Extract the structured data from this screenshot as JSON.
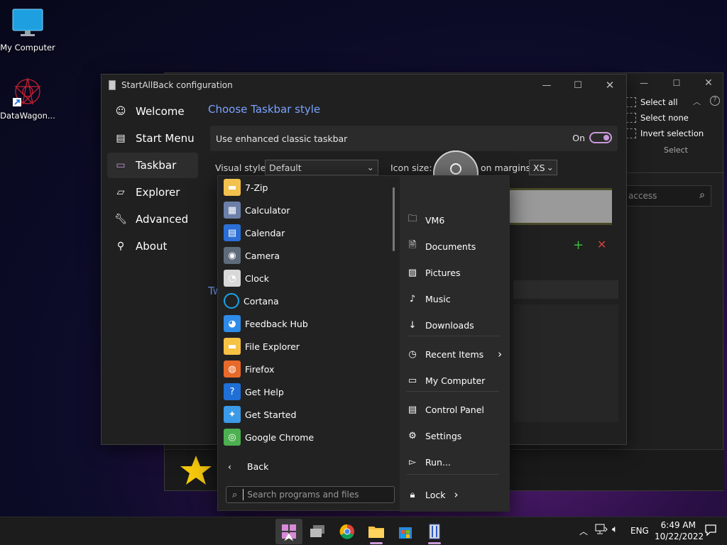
{
  "desktop": {
    "icons": [
      {
        "label": "My Computer"
      },
      {
        "label": "DataWagon..."
      }
    ]
  },
  "bg_window": {
    "ribbon": [
      "Select all",
      "Select none",
      "Invert selection"
    ],
    "ribbon_group_label": "Select",
    "search_placeholder": "access"
  },
  "window": {
    "title": "StartAllBack configuration",
    "nav": [
      {
        "label": "Welcome",
        "icon": "smiley-icon"
      },
      {
        "label": "Start Menu",
        "icon": "start-menu-icon"
      },
      {
        "label": "Taskbar",
        "icon": "taskbar-icon",
        "active": true
      },
      {
        "label": "Explorer",
        "icon": "explorer-icon"
      },
      {
        "label": "Advanced",
        "icon": "wrench-icon"
      },
      {
        "label": "About",
        "icon": "info-icon"
      }
    ],
    "content_title": "Choose Taskbar style",
    "enhanced_label": "Use enhanced classic taskbar",
    "toggle_state": "On",
    "visual_style_label": "Visual style:",
    "visual_style_value": "Default",
    "icon_size_label": "Icon size:",
    "icon_margins_label": "on margins:",
    "icon_margins_value": "XS",
    "section_partial": "Tw"
  },
  "start_menu": {
    "programs": [
      {
        "label": "7-Zip",
        "icon": "folder-icon",
        "color": "#f2c14e"
      },
      {
        "label": "Calculator",
        "icon": "calculator-icon",
        "color": "#6b7fa8"
      },
      {
        "label": "Calendar",
        "icon": "calendar-icon",
        "color": "#2b6fd6"
      },
      {
        "label": "Camera",
        "icon": "camera-icon",
        "color": "#5f6b7a"
      },
      {
        "label": "Clock",
        "icon": "clock-icon",
        "color": "#d8d8d8"
      },
      {
        "label": "Cortana",
        "icon": "cortana-icon",
        "color": "#1aa3e8"
      },
      {
        "label": "Feedback Hub",
        "icon": "feedback-hub-icon",
        "color": "#2e8be8"
      },
      {
        "label": "File Explorer",
        "icon": "file-explorer-icon",
        "color": "#f5c243"
      },
      {
        "label": "Firefox",
        "icon": "firefox-icon",
        "color": "#e86a2a"
      },
      {
        "label": "Get Help",
        "icon": "get-help-icon",
        "color": "#1f6fd6"
      },
      {
        "label": "Get Started",
        "icon": "get-started-icon",
        "color": "#3b9be8"
      },
      {
        "label": "Google Chrome",
        "icon": "chrome-icon",
        "color": "#4caf50"
      }
    ],
    "back_label": "Back",
    "search_placeholder": "Search programs and files",
    "right_items": [
      {
        "label": "VM6",
        "icon": "user-folder-icon"
      },
      {
        "label": "Documents",
        "icon": "document-icon"
      },
      {
        "label": "Pictures",
        "icon": "picture-icon"
      },
      {
        "label": "Music",
        "icon": "music-icon"
      },
      {
        "label": "Downloads",
        "icon": "download-icon"
      },
      {
        "label": "Recent Items",
        "icon": "clock-outline-icon",
        "arrow": true
      },
      {
        "label": "My Computer",
        "icon": "computer-icon"
      },
      {
        "label": "Control Panel",
        "icon": "control-panel-icon"
      },
      {
        "label": "Settings",
        "icon": "gear-icon"
      },
      {
        "label": "Run...",
        "icon": "run-icon"
      },
      {
        "label": "Lock",
        "icon": "lock-icon",
        "arrow": true
      }
    ]
  },
  "taskbar": {
    "apps": [
      "start-button",
      "task-view",
      "chrome",
      "file-explorer",
      "store",
      "startallback"
    ],
    "language": "ENG",
    "time": "6:49 AM",
    "date": "10/22/2022"
  },
  "colors": {
    "accent": "#c89ad8",
    "link_blue": "#7aa3ff",
    "window_bg": "#202020"
  }
}
